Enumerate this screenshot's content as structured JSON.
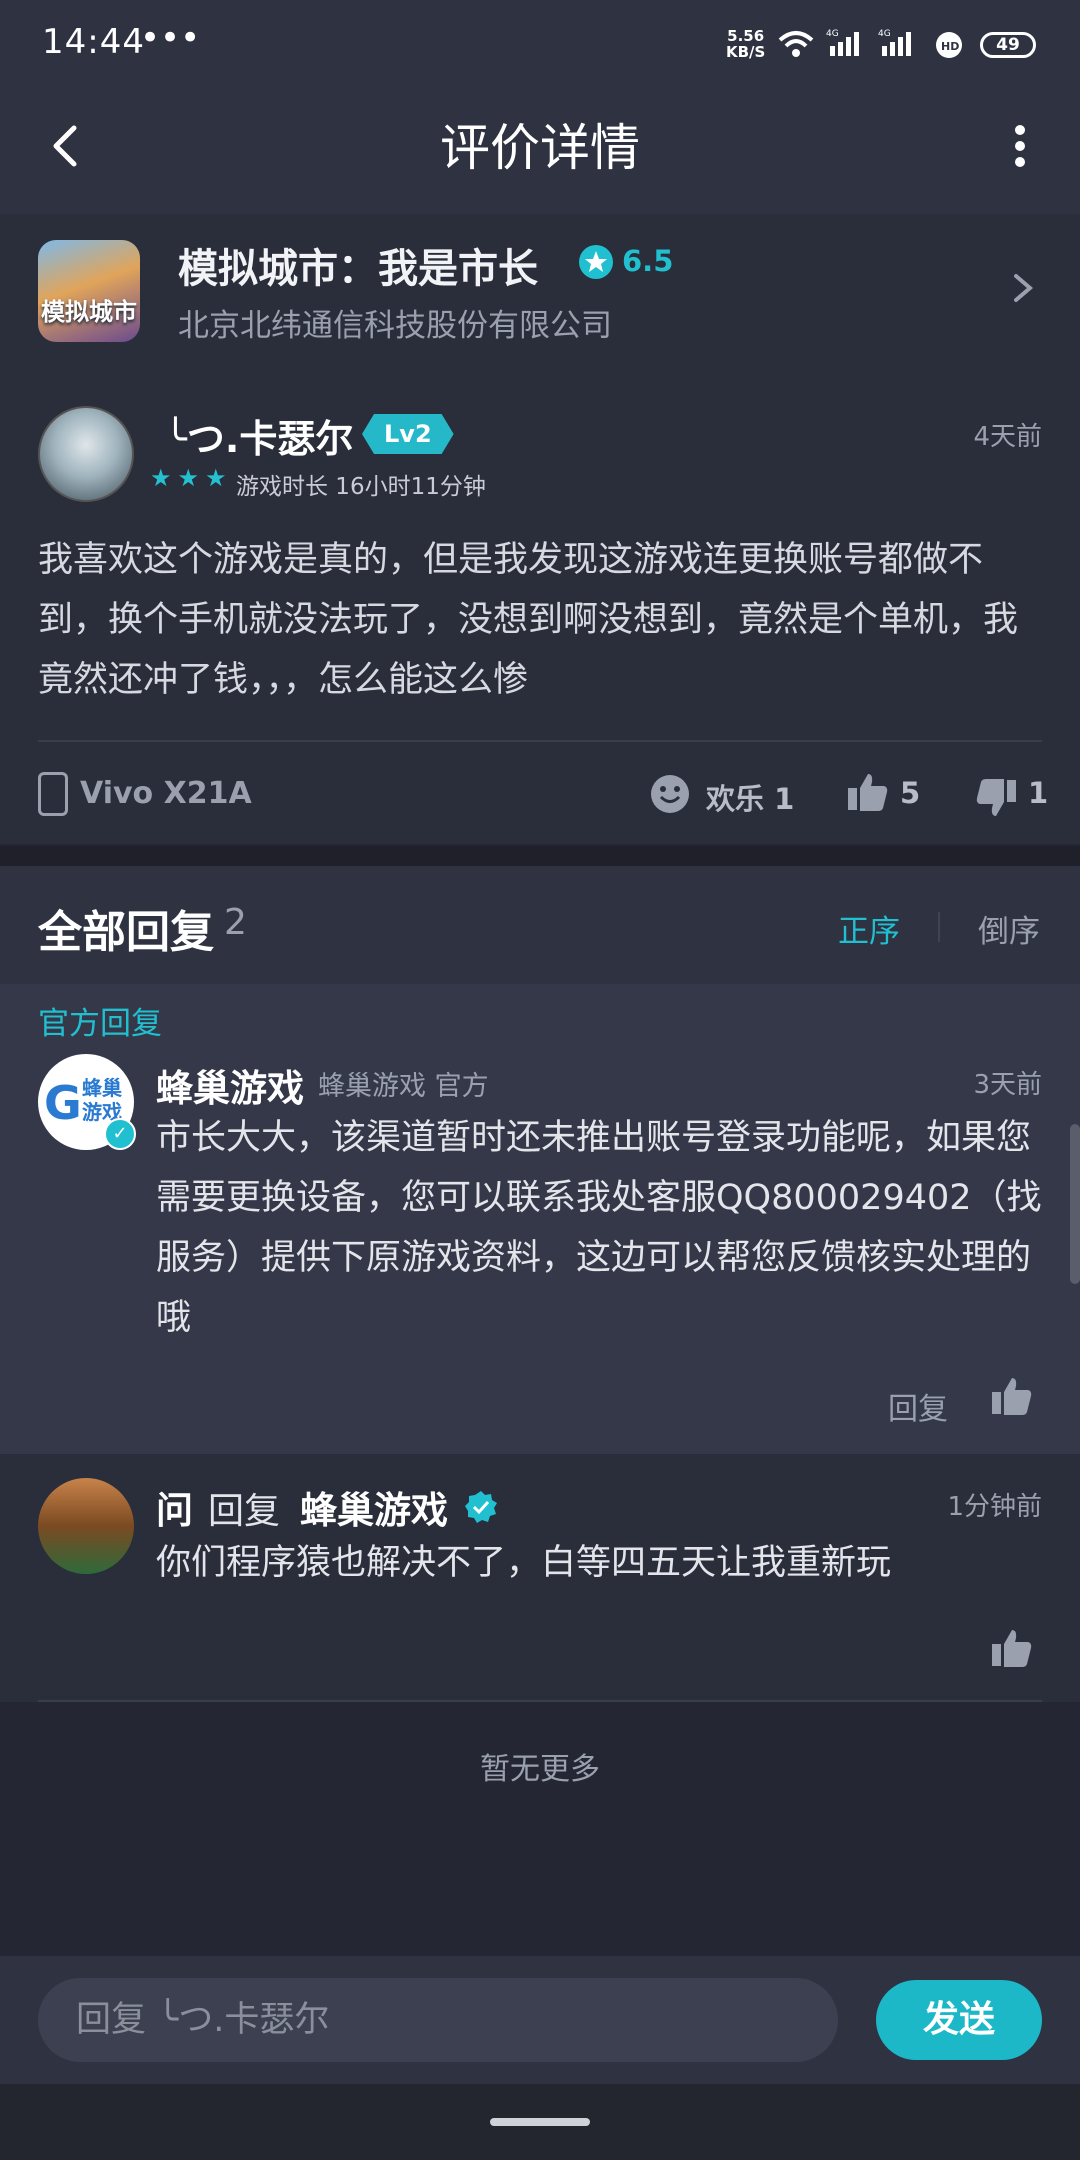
{
  "status": {
    "time": "14:44",
    "more": "•••",
    "speed": "5.56\nKB/S",
    "battery": "49"
  },
  "header": {
    "title": "评价详情"
  },
  "game": {
    "icon_text": "模拟城市",
    "name": "模拟城市：我是市长",
    "rating": "6.5",
    "developer": "北京北纬通信科技股份有限公司"
  },
  "review": {
    "username": "╰つ.卡瑟尔",
    "level": "Lv2",
    "stars": "★★★",
    "playtime": "游戏时长 16小时11分钟",
    "time": "4天前",
    "text": "我喜欢这个游戏是真的，但是我发现这游戏连更换账号都做不到，换个手机就没法玩了，没想到啊没想到，竟然是个单机，我竟然还冲了钱，，，怎么能这么惨",
    "device": "Vivo X21A",
    "happy": "欢乐 1",
    "likes": "5",
    "dislikes": "1"
  },
  "replies": {
    "title": "全部回复",
    "count": "2",
    "sort_asc": "正序",
    "sort_desc": "倒序",
    "official_label": "官方回复",
    "official": {
      "avatar_g": "G",
      "avatar_text": "蜂巢\n游戏",
      "name": "蜂巢游戏",
      "subtitle": "蜂巢游戏 官方",
      "time": "3天前",
      "text": "市长大大，该渠道暂时还未推出账号登录功能呢，如果您需要更换设备，您可以联系我处客服QQ800029402（找服务）提供下原游戏资料，这边可以帮您反馈核实处理的哦",
      "reply_label": "回复"
    },
    "second": {
      "user": "问",
      "verb": "回复",
      "target": "蜂巢游戏",
      "time": "1分钟前",
      "text": "你们程序猿也解决不了，白等四五天让我重新玩"
    },
    "no_more": "暂无更多"
  },
  "composer": {
    "placeholder": "回复 ╰つ.卡瑟尔",
    "send": "发送"
  },
  "colors": {
    "accent": "#20c0d0",
    "bg": "#242633"
  }
}
